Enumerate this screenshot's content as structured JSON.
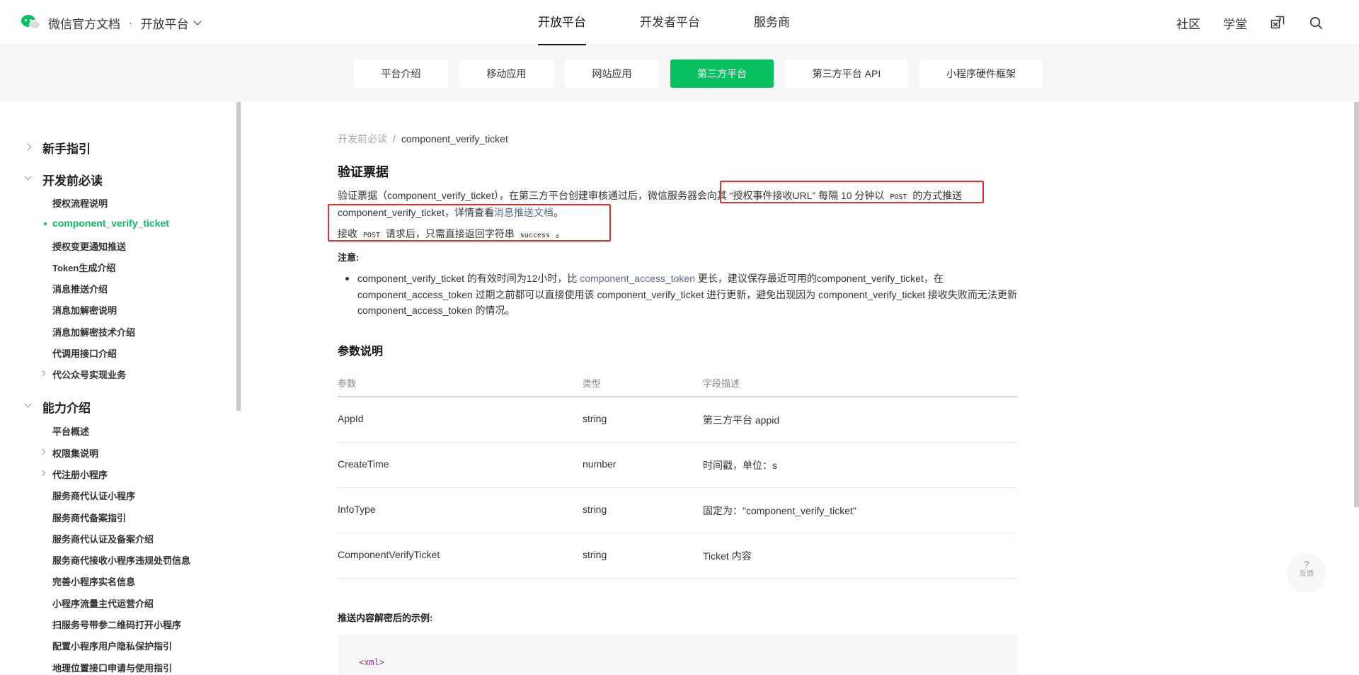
{
  "header": {
    "brand_title": "微信官方文档",
    "brand_dot": "·",
    "platform_label": "开放平台",
    "nav": [
      {
        "label": "开放平台",
        "active": true
      },
      {
        "label": "开发者平台",
        "active": false
      },
      {
        "label": "服务商",
        "active": false
      }
    ],
    "right_links": [
      "社区",
      "学堂"
    ],
    "icons": [
      "translate-icon",
      "search-icon"
    ]
  },
  "subtabs": [
    {
      "label": "平台介绍",
      "active": false
    },
    {
      "label": "移动应用",
      "active": false
    },
    {
      "label": "网站应用",
      "active": false
    },
    {
      "label": "第三方平台",
      "active": true
    },
    {
      "label": "第三方平台 API",
      "active": false
    },
    {
      "label": "小程序硬件框架",
      "active": false
    }
  ],
  "sidebar": {
    "groups": [
      {
        "label": "新手指引",
        "expanded": false
      },
      {
        "label": "开发前必读",
        "expanded": true
      },
      {
        "label": "能力介绍",
        "expanded": true
      }
    ],
    "items_group2": [
      {
        "label": "授权流程说明",
        "has_children": false,
        "active": false
      },
      {
        "label": "component_verify_ticket",
        "has_children": false,
        "active": true
      },
      {
        "label": "授权变更通知推送",
        "has_children": false,
        "active": false
      },
      {
        "label": "Token生成介绍",
        "has_children": false,
        "active": false
      },
      {
        "label": "消息推送介绍",
        "has_children": false,
        "active": false
      },
      {
        "label": "消息加解密说明",
        "has_children": false,
        "active": false
      },
      {
        "label": "消息加解密技术介绍",
        "has_children": false,
        "active": false
      },
      {
        "label": "代调用接口介绍",
        "has_children": false,
        "active": false
      },
      {
        "label": "代公众号实现业务",
        "has_children": true,
        "active": false
      }
    ],
    "items_group3": [
      {
        "label": "平台概述",
        "has_children": false
      },
      {
        "label": "权限集说明",
        "has_children": true
      },
      {
        "label": "代注册小程序",
        "has_children": true
      },
      {
        "label": "服务商代认证小程序",
        "has_children": false
      },
      {
        "label": "服务商代备案指引",
        "has_children": false
      },
      {
        "label": "服务商代认证及备案介绍",
        "has_children": false
      },
      {
        "label": "服务商代接收小程序违规处罚信息",
        "has_children": false
      },
      {
        "label": "完善小程序实名信息",
        "has_children": false
      },
      {
        "label": "小程序流量主代运营介绍",
        "has_children": false
      },
      {
        "label": "扫服务号带参二维码打开小程序",
        "has_children": false
      },
      {
        "label": "配置小程序用户隐私保护指引",
        "has_children": false
      },
      {
        "label": "地理位置接口申请与使用指引",
        "has_children": false
      }
    ]
  },
  "content": {
    "breadcrumb_parent": "开发前必读",
    "breadcrumb_sep": "/",
    "breadcrumb_current": "component_verify_ticket",
    "title": "验证票据",
    "p1_a": "验证票据（component_verify_ticket），在第三方平台创建审核通过后，微信服务器会向其 “授权事件接收URL” 每隔 10 分钟以 ",
    "p1_code": "POST",
    "p1_b": " 的方式推送",
    "p2_a": "component_verify_ticket，详情查看",
    "p2_link": "消息推送文档",
    "p2_b": "。",
    "p3_a": "接收 ",
    "p3_code1": "POST",
    "p3_b": " 请求后，只需直接返回字符串 ",
    "p3_code2": "success",
    "p3_c": " 。",
    "note_label": "注意:",
    "bullet_a": "component_verify_ticket 的有效时间为12小时，比 ",
    "bullet_link": "component_access_token",
    "bullet_b": " 更长，建议保存最近可用的component_verify_ticket，在 component_access_token 过期之前都可以直接使用该 component_verify_ticket 进行更新，避免出现因为 component_verify_ticket 接收失败而无法更新 component_access_token 的情况。",
    "params_title": "参数说明",
    "table": {
      "headers": [
        "参数",
        "类型",
        "字段描述"
      ],
      "rows": [
        [
          "AppId",
          "string",
          "第三方平台 appid"
        ],
        [
          "CreateTime",
          "number",
          "时间戳，单位：s"
        ],
        [
          "InfoType",
          "string",
          "固定为：\"component_verify_ticket\""
        ],
        [
          "ComponentVerifyTicket",
          "string",
          "Ticket 内容"
        ]
      ]
    },
    "example_label": "推送内容解密后的示例:",
    "code_lt": "<",
    "code_tag": "xml",
    "code_gt": ">"
  },
  "feedback": {
    "symbol": "?",
    "label": "反馈"
  },
  "colors": {
    "brand_green": "#07c160",
    "link": "#576b95",
    "annotation_red": "#e0302f"
  }
}
